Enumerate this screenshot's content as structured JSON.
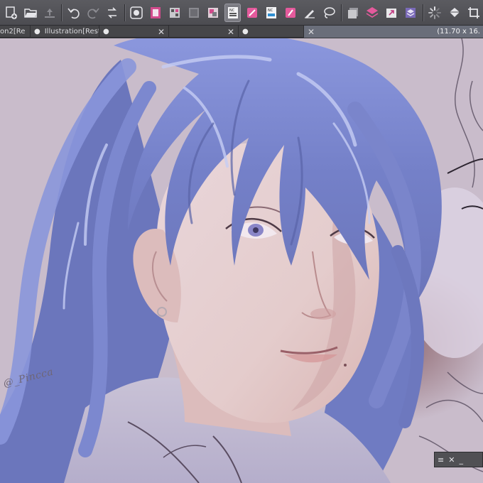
{
  "toolbar": {
    "buttons": [
      {
        "name": "new-file-icon"
      },
      {
        "name": "open-folder-icon"
      },
      {
        "name": "save-icon"
      },
      {
        "name": "undo-icon"
      },
      {
        "name": "redo-icon"
      },
      {
        "name": "transform-icon"
      },
      {
        "name": "clear-icon"
      },
      {
        "name": "film-icon"
      },
      {
        "name": "layer-grid-icon"
      },
      {
        "name": "thumbnail-icon"
      },
      {
        "name": "nc-layer-icon"
      },
      {
        "name": "pen-pink-icon"
      },
      {
        "name": "nc-blue-icon"
      },
      {
        "name": "pink-layer-icon"
      },
      {
        "name": "ruler-pen-icon"
      },
      {
        "name": "lasso-icon"
      },
      {
        "name": "layer-stack-icon"
      },
      {
        "name": "layers-pink-icon"
      },
      {
        "name": "folder-arrow-icon"
      },
      {
        "name": "layers-purple-icon"
      },
      {
        "name": "loading-icon"
      },
      {
        "name": "fill-icon"
      },
      {
        "name": "crop-icon"
      }
    ]
  },
  "tabs": [
    {
      "label": "on2[Re",
      "dot": "",
      "close": ""
    },
    {
      "label": "Illustration[Resto",
      "dot": "●",
      "close": ""
    },
    {
      "label": "",
      "dot": "●",
      "close": "✕"
    },
    {
      "label": "",
      "dot": "",
      "close": "✕"
    },
    {
      "label": "",
      "dot": "●",
      "close": ""
    },
    {
      "label": "",
      "dot": "",
      "close": "✕",
      "size": "(11.70 x 16."
    }
  ],
  "canvas": {
    "signature": "@_Pincca"
  },
  "mini_panel": {
    "menu_icon": "≡",
    "close_icon": "✕",
    "minimize_icon": "_"
  },
  "colors": {
    "toolbar_bg": "#525257",
    "canvas_bg": "#c9bccb",
    "hair": "#7a86cc",
    "skin": "#e6cfcf"
  }
}
